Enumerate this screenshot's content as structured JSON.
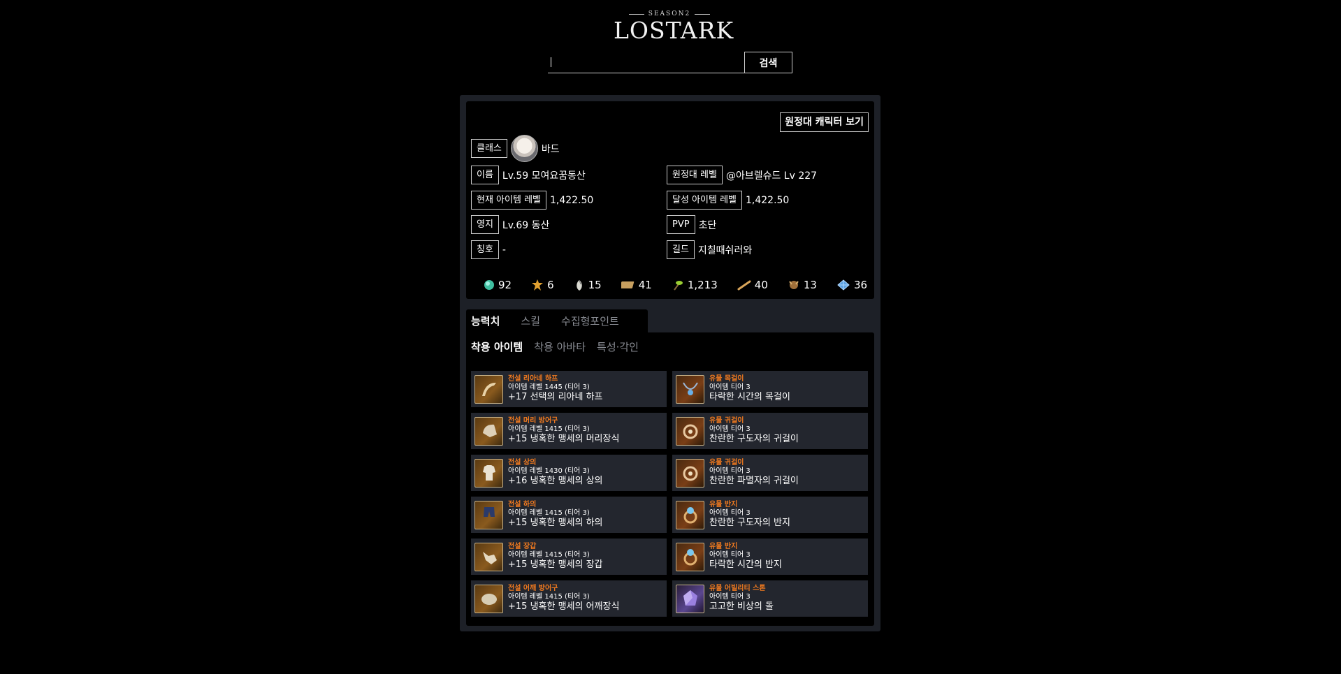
{
  "logo": {
    "season": "SEASON2",
    "name": "LOSTARK"
  },
  "search": {
    "placeholder": "",
    "value": "",
    "button": "검색"
  },
  "profile": {
    "expedition_button": "원정대 캐릭터 보기",
    "class": {
      "label": "클래스",
      "value": "바드"
    },
    "left": [
      {
        "label": "이름",
        "value": "Lv.59 모여요꿈동산"
      },
      {
        "label": "현재 아이템 레벨",
        "value": "1,422.50"
      },
      {
        "label": "영지",
        "value": "Lv.69 동산"
      },
      {
        "label": "칭호",
        "value": "-"
      }
    ],
    "right": [
      {
        "label": "원정대 레벨",
        "value": "@아브렐슈드 Lv 227"
      },
      {
        "label": "달성 아이템 레벨",
        "value": "1,422.50"
      },
      {
        "label": "PVP",
        "value": "초단"
      },
      {
        "label": "길드",
        "value": "지칠때쉬러와"
      }
    ],
    "collectibles": [
      {
        "icon": "island-heart-icon",
        "value": "92"
      },
      {
        "icon": "giant-heart-icon",
        "value": "6"
      },
      {
        "icon": "mokoko-seed-icon",
        "value": "15"
      },
      {
        "icon": "art-icon",
        "value": "41"
      },
      {
        "icon": "sprout-icon",
        "value": "1,213"
      },
      {
        "icon": "flute-icon",
        "value": "40"
      },
      {
        "icon": "medal-icon",
        "value": "13"
      },
      {
        "icon": "leaf-icon",
        "value": "36"
      }
    ]
  },
  "tabs": [
    "능력치",
    "스킬",
    "수집형포인트"
  ],
  "subtabs": [
    "착용 아이템",
    "착용 아바타",
    "특성·각인"
  ],
  "equipment": [
    {
      "grade": "전설 리아네 하프",
      "level": "아이템 레벨 1445 (티어 3)",
      "name": "+17 선택의 리아네 하프",
      "icon": "harp-icon"
    },
    {
      "grade": "전설 머리 방어구",
      "level": "아이템 레벨 1415 (티어 3)",
      "name": "+15 냉혹한 맹세의 머리장식",
      "icon": "helmet-icon"
    },
    {
      "grade": "전설 상의",
      "level": "아이템 레벨 1430 (티어 3)",
      "name": "+16 냉혹한 맹세의 상의",
      "icon": "top-armor-icon"
    },
    {
      "grade": "전설 하의",
      "level": "아이템 레벨 1415 (티어 3)",
      "name": "+15 냉혹한 맹세의 하의",
      "icon": "pants-icon"
    },
    {
      "grade": "전설 장갑",
      "level": "아이템 레벨 1415 (티어 3)",
      "name": "+15 냉혹한 맹세의 장갑",
      "icon": "gloves-icon"
    },
    {
      "grade": "전설 어깨 방어구",
      "level": "아이템 레벨 1415 (티어 3)",
      "name": "+15 냉혹한 맹세의 어깨장식",
      "icon": "shoulder-icon"
    }
  ],
  "accessories": [
    {
      "grade": "유물 목걸이",
      "level": "아이템 티어 3",
      "name": "타락한 시간의 목걸이",
      "icon": "necklace-icon"
    },
    {
      "grade": "유물 귀걸이",
      "level": "아이템 티어 3",
      "name": "찬란한 구도자의 귀걸이",
      "icon": "earring-icon"
    },
    {
      "grade": "유물 귀걸이",
      "level": "아이템 티어 3",
      "name": "찬란한 파멸자의 귀걸이",
      "icon": "earring-icon"
    },
    {
      "grade": "유물 반지",
      "level": "아이템 티어 3",
      "name": "찬란한 구도자의 반지",
      "icon": "ring-icon"
    },
    {
      "grade": "유물 반지",
      "level": "아이템 티어 3",
      "name": "타락한 시간의 반지",
      "icon": "ring-icon"
    },
    {
      "grade": "유물 어빌리티 스톤",
      "level": "아이템 티어 3",
      "name": "고고한 비상의 돌",
      "icon": "ability-stone-icon"
    }
  ],
  "colors": {
    "grade_orange": "#f17a1f",
    "panel": "#1d2027",
    "item_bg": "#23262e"
  }
}
